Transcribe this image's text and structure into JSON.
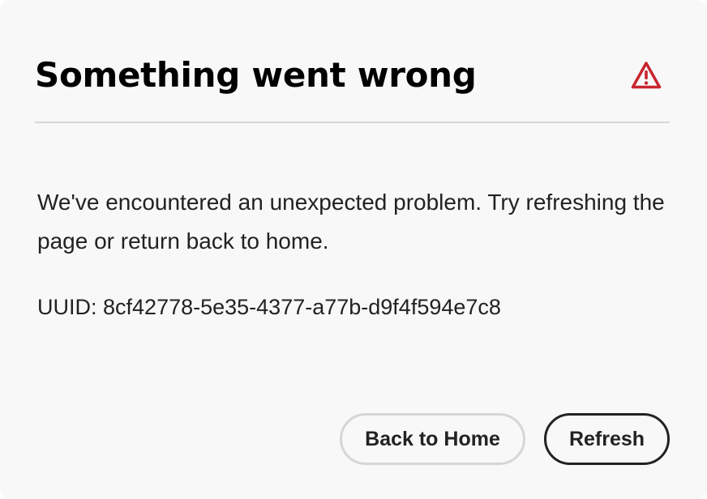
{
  "dialog": {
    "title": "Something went wrong",
    "icon": "alert-triangle-icon",
    "icon_color": "#c9252d",
    "message": "We've encountered an unexpected problem. Try refreshing the page or return back to home.",
    "uuid_label": "UUID:",
    "uuid_value": "8cf42778-5e35-4377-a77b-d9f4f594e7c8",
    "buttons": {
      "back_home": "Back to Home",
      "refresh": "Refresh"
    }
  }
}
